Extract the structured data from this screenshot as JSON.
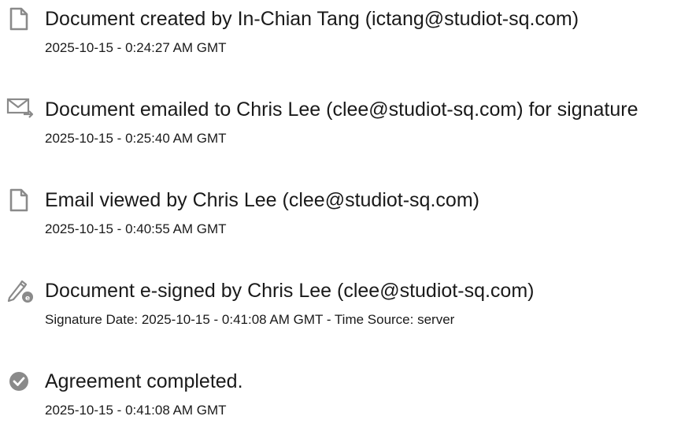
{
  "events": [
    {
      "icon": "document-icon",
      "title": "Document created by In-Chian Tang (ictang@studiot-sq.com)",
      "detail": "2025-10-15 - 0:24:27 AM GMT"
    },
    {
      "icon": "email-sent-icon",
      "title": "Document emailed to Chris Lee (clee@studiot-sq.com) for signature",
      "detail": "2025-10-15 - 0:25:40 AM GMT"
    },
    {
      "icon": "document-icon",
      "title": "Email viewed by Chris Lee (clee@studiot-sq.com)",
      "detail": "2025-10-15 - 0:40:55 AM GMT"
    },
    {
      "icon": "pen-sign-icon",
      "title": "Document e-signed by Chris Lee (clee@studiot-sq.com)",
      "detail": "Signature Date: 2025-10-15 - 0:41:08 AM GMT - Time Source: server"
    },
    {
      "icon": "check-circle-icon",
      "title": "Agreement completed.",
      "detail": "2025-10-15 - 0:41:08 AM GMT"
    }
  ],
  "colors": {
    "icon": "#8a8a8a",
    "text": "#1a1a1a"
  }
}
